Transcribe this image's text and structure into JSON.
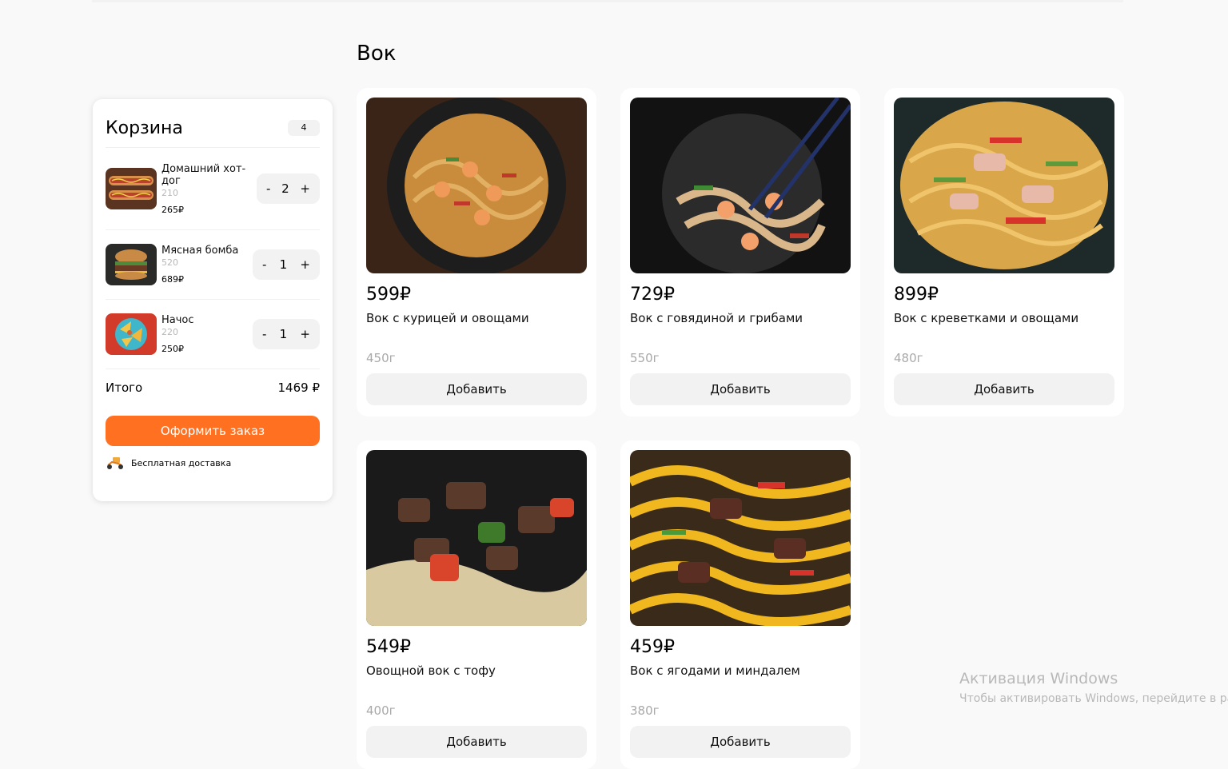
{
  "section": {
    "title": "Вок"
  },
  "cart": {
    "title": "Корзина",
    "count": "4",
    "items": [
      {
        "name": "Домашний хот-дог",
        "weight": "210",
        "price": "265₽",
        "qty": "2",
        "minus": "-",
        "plus": "+"
      },
      {
        "name": "Мясная бомба",
        "weight": "520",
        "price": "689₽",
        "qty": "1",
        "minus": "-",
        "plus": "+"
      },
      {
        "name": "Начос",
        "weight": "220",
        "price": "250₽",
        "qty": "1",
        "minus": "-",
        "plus": "+"
      }
    ],
    "total_label": "Итого",
    "total_value": "1469 ₽",
    "order_label": "Оформить заказ",
    "delivery_label": "Бесплатная доставка"
  },
  "products": [
    {
      "price": "599₽",
      "name": "Вок с курицей и овощами",
      "weight": "450г",
      "button": "Добавить"
    },
    {
      "price": "729₽",
      "name": "Вок с говядиной и грибами",
      "weight": "550г",
      "button": "Добавить"
    },
    {
      "price": "899₽",
      "name": "Вок с креветками и овощами",
      "weight": "480г",
      "button": "Добавить"
    },
    {
      "price": "549₽",
      "name": "Овощной вок с тофу",
      "weight": "400г",
      "button": "Добавить"
    },
    {
      "price": "459₽",
      "name": "Вок с ягодами и миндалем",
      "weight": "380г",
      "button": "Добавить"
    }
  ],
  "watermark": {
    "line1": "Активация Windows",
    "line2": "Чтобы активировать Windows, перейдите в разд"
  },
  "colors": {
    "accent": "#ff7020",
    "page_bg": "#f9f9f9",
    "muted": "#a9a9a9"
  }
}
